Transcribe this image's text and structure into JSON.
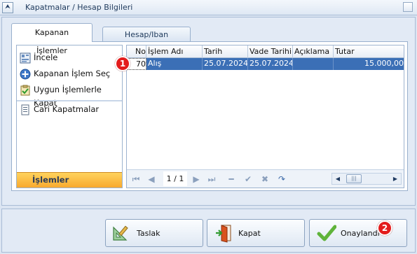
{
  "window": {
    "title": "Kapatmalar / Hesap Bilgileri",
    "collapse_glyph": "⮝"
  },
  "tabs": [
    {
      "label": "Kapanan İşlemler",
      "active": true
    },
    {
      "label": "Hesap/Iban Bilgileri",
      "active": false
    }
  ],
  "side_menu": {
    "items": [
      {
        "label": "İncele",
        "icon": "inspect-icon"
      },
      {
        "label": "Kapanan İşlem Seç",
        "icon": "add-circle-icon"
      },
      {
        "label": "Uygun İşlemlerle Kapat",
        "icon": "clipboard-check-icon"
      },
      {
        "label": "Cari Kapatmalar",
        "icon": "document-icon"
      }
    ],
    "footer_label": "İşlemler"
  },
  "grid": {
    "columns": [
      "No",
      "İşlem Adı",
      "Tarih",
      "Vade Tarihi",
      "Açıklama",
      "Tutar"
    ],
    "rows": [
      {
        "no": "70",
        "islem_adi": "Alış",
        "tarih": "25.07.2024",
        "vade_tarihi": "25.07.2024",
        "aciklama": "",
        "tutar": "15.000,00"
      }
    ],
    "pager_text": "1 / 1"
  },
  "callouts": {
    "first": "1",
    "second": "2"
  },
  "buttons": {
    "taslak": "Taslak",
    "kapat": "Kapat",
    "onaylandi": "Onaylandı"
  },
  "colors": {
    "selection": "#3b6fb6",
    "accent_orange": "#f8a92e",
    "callout_red": "#e31c1c"
  }
}
